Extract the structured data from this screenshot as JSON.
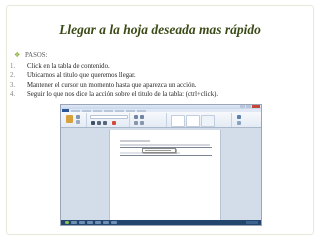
{
  "slide": {
    "title": "Llegar a la hoja deseada mas rápido",
    "bullet_label": "PASOS:",
    "steps": [
      {
        "number": "1.",
        "text": "Click en la tabla de contenido."
      },
      {
        "number": "2.",
        "text": "Ubicarnos al titulo que queremos llegar."
      },
      {
        "number": "3.",
        "text": "Mantener el cursor un momento hasta que aparezca un acción."
      },
      {
        "number": "4.",
        "text": "Seguir lo que nos dice la acción sobre el titulo de la tabla: (ctrl+click)."
      }
    ]
  },
  "colors": {
    "title": "#3a4a16",
    "bullet_accent": "#8db13a",
    "word_ribbon": "#e3ebf5",
    "word_file_tab": "#2a5698",
    "taskbar": "#23466f"
  },
  "screenshot": {
    "application": "Microsoft Word",
    "icons": [
      "minimize-icon",
      "maximize-icon",
      "close-icon"
    ]
  }
}
